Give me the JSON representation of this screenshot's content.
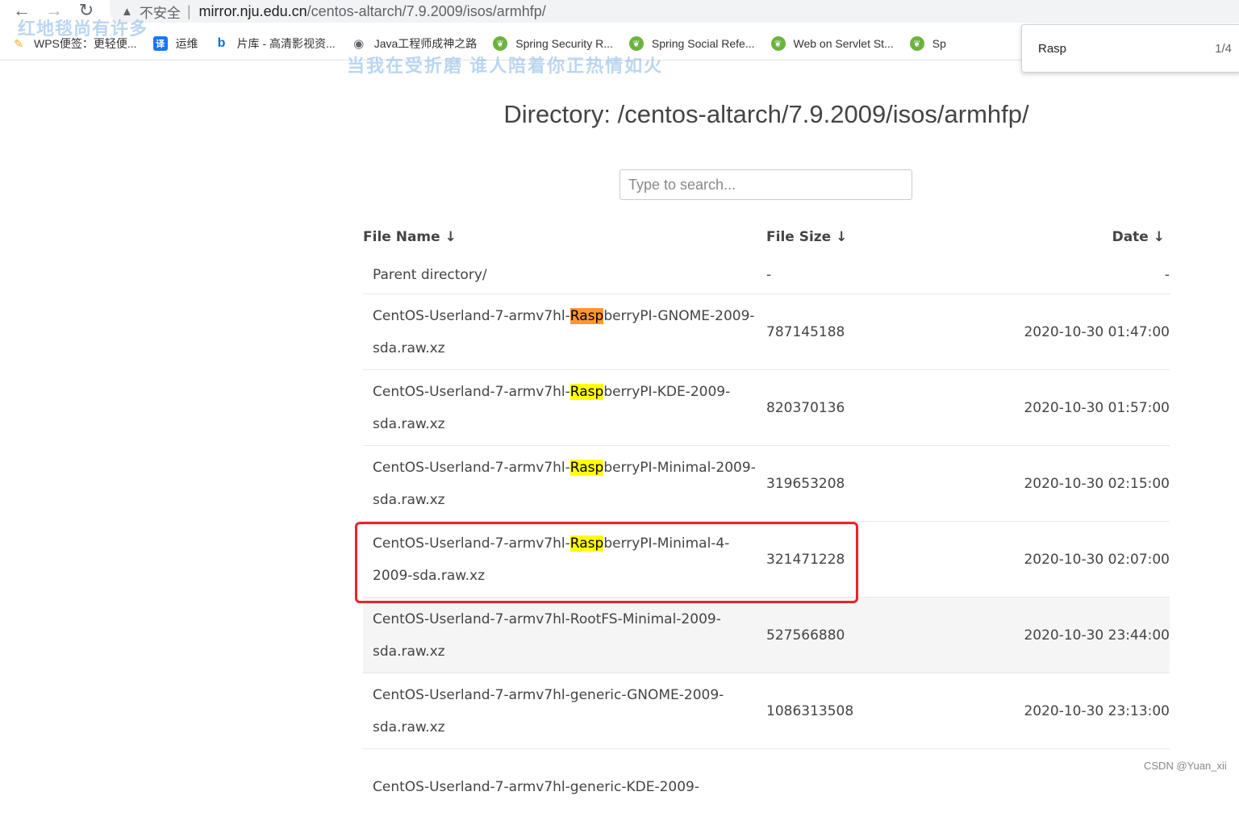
{
  "browser": {
    "insecure_label": "不安全",
    "separator": "|",
    "url_host": "mirror.nju.edu.cn",
    "url_path": "/centos-altarch/7.9.2009/isos/armhfp/",
    "bookmarks": [
      {
        "label": "WPS便签：更轻便...",
        "icon": "wps-icon"
      },
      {
        "label": "运维",
        "icon": "translate-icon"
      },
      {
        "label": "片库 - 高清影视资...",
        "icon": "bing-icon"
      },
      {
        "label": "Java工程师成神之路",
        "icon": "globe-icon"
      },
      {
        "label": "Spring Security R...",
        "icon": "spring-icon"
      },
      {
        "label": "Spring Social Refe...",
        "icon": "spring-icon"
      },
      {
        "label": "Web on Servlet St...",
        "icon": "spring-icon"
      },
      {
        "label": "Sp",
        "icon": "spring-icon"
      }
    ],
    "find": {
      "query": "Rasp",
      "count": "1/4"
    }
  },
  "overlays": {
    "watermark_top": "红地毯尚有许多",
    "watermark_banner": "当我在受折磨 谁人陪着你正热情如火",
    "footer": "CSDN @Yuan_xii"
  },
  "page": {
    "title": "Directory: /centos-altarch/7.9.2009/isos/armhfp/",
    "search_placeholder": "Type to search...",
    "columns": {
      "name": "File Name ↓",
      "size": "File Size ↓",
      "date": "Date ↓"
    },
    "parent": {
      "name": "Parent directory/",
      "size": "-",
      "date": "-"
    },
    "files": [
      {
        "pre": "CentOS-Userland-7-armv7hl-",
        "hl": "Rasp",
        "post": "berryPI-GNOME-2009-sda.raw.xz",
        "size": "787145188",
        "date": "2020-10-30 01:47:00"
      },
      {
        "pre": "CentOS-Userland-7-armv7hl-",
        "hl": "Rasp",
        "post": "berryPI-KDE-2009-sda.raw.xz",
        "size": "820370136",
        "date": "2020-10-30 01:57:00"
      },
      {
        "pre": "CentOS-Userland-7-armv7hl-",
        "hl": "Rasp",
        "post": "berryPI-Minimal-2009-sda.raw.xz",
        "size": "319653208",
        "date": "2020-10-30 02:15:00"
      },
      {
        "pre": "CentOS-Userland-7-armv7hl-",
        "hl": "Rasp",
        "post": "berryPI-Minimal-4-2009-sda.raw.xz",
        "size": "321471228",
        "date": "2020-10-30 02:07:00"
      },
      {
        "pre": "CentOS-Userland-7-armv7hl-RootFS-Minimal-2009-sda.raw.xz",
        "hl": "",
        "post": "",
        "size": "527566880",
        "date": "2020-10-30 23:44:00"
      },
      {
        "pre": "CentOS-Userland-7-armv7hl-generic-GNOME-2009-sda.raw.xz",
        "hl": "",
        "post": "",
        "size": "1086313508",
        "date": "2020-10-30 23:13:00"
      },
      {
        "pre": "CentOS-Userland-7-armv7hl-generic-KDE-2009-",
        "hl": "",
        "post": "",
        "size": "",
        "date": ""
      }
    ]
  },
  "colors": {
    "find_active": "#ff9632",
    "find_match": "#ffff00",
    "annotation_box": "#e8232d"
  }
}
